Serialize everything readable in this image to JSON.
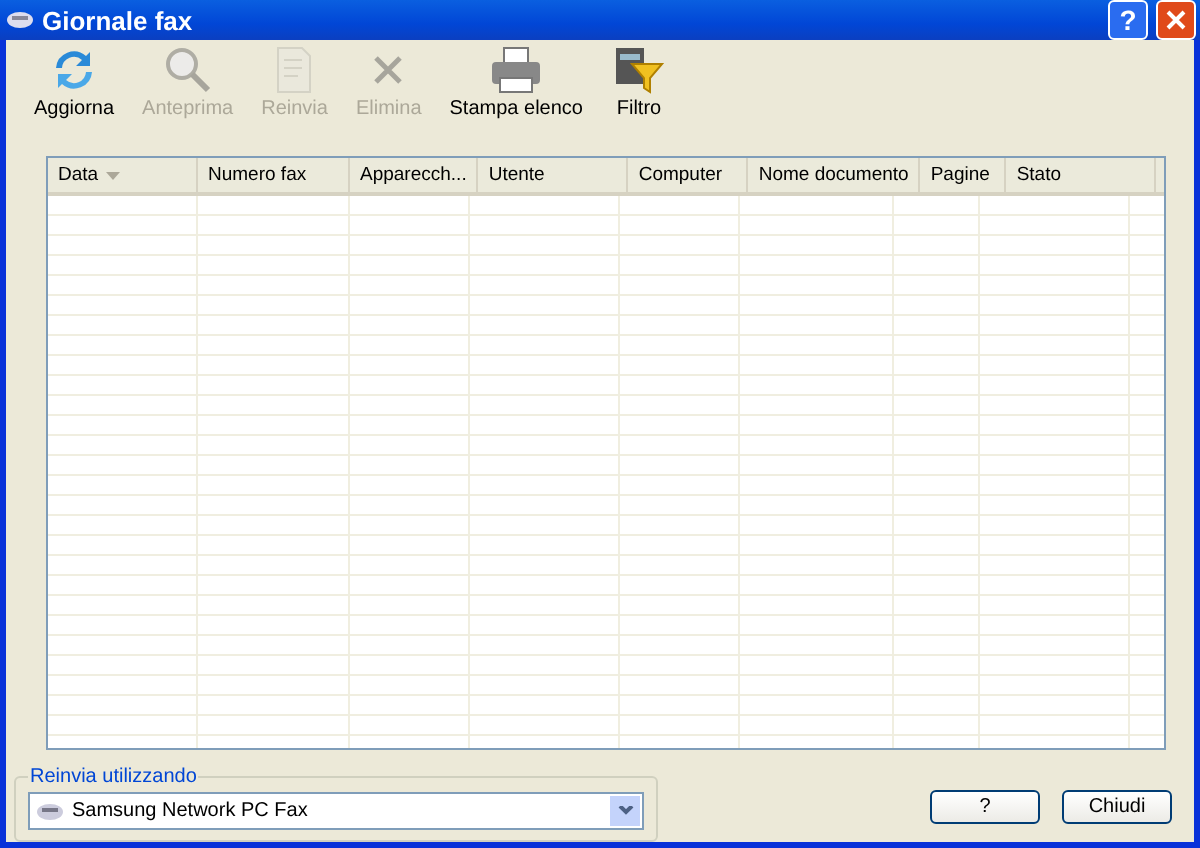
{
  "window": {
    "title": "Giornale fax",
    "help": "?"
  },
  "toolbar": [
    {
      "kind": "refresh",
      "label": "Aggiorna",
      "disabled": false
    },
    {
      "kind": "preview",
      "label": "Anteprima",
      "disabled": true
    },
    {
      "kind": "resend",
      "label": "Reinvia",
      "disabled": true
    },
    {
      "kind": "delete",
      "label": "Elimina",
      "disabled": true
    },
    {
      "kind": "print",
      "label": "Stampa elenco",
      "disabled": false
    },
    {
      "kind": "filter",
      "label": "Filtro",
      "disabled": false
    }
  ],
  "table": {
    "columns": [
      {
        "label": "Data",
        "sorted": true
      },
      {
        "label": "Numero fax",
        "sorted": false
      },
      {
        "label": "Apparecch...",
        "sorted": false
      },
      {
        "label": "Utente",
        "sorted": false
      },
      {
        "label": "Computer",
        "sorted": false
      },
      {
        "label": "Nome documento",
        "sorted": false
      },
      {
        "label": "Pagine",
        "sorted": false
      },
      {
        "label": "Stato",
        "sorted": false
      }
    ]
  },
  "resend_group": {
    "label": "Reinvia utilizzando",
    "value": "Samsung Network PC Fax"
  },
  "buttons": [
    "?",
    "Chiudi"
  ]
}
